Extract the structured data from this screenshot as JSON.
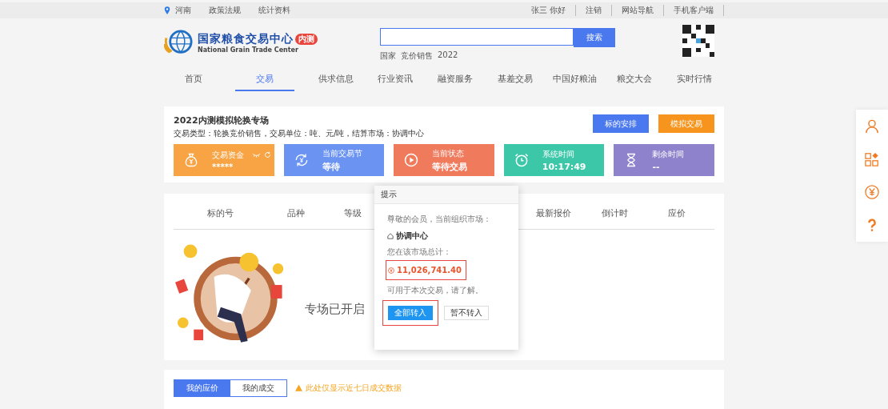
{
  "top_bar": {
    "location": "河南",
    "links": [
      "政策法规",
      "统计资料"
    ],
    "user_links": [
      "张三 你好",
      "注销",
      "网站导航",
      "手机客户端"
    ]
  },
  "header": {
    "logo_title": "国家粮食交易中心",
    "logo_badge": "内测",
    "logo_subtitle": "National Grain Trade Center",
    "search": {
      "button": "搜索"
    },
    "hot_words": [
      "国家",
      "竞价销售",
      "2022"
    ]
  },
  "nav": [
    {
      "label": "首页",
      "selected": false
    },
    {
      "label": "交易",
      "selected": true
    },
    {
      "label": "供求信息",
      "selected": false
    },
    {
      "label": "行业资讯",
      "selected": false
    },
    {
      "label": "融资服务",
      "selected": false
    },
    {
      "label": "基差交易",
      "selected": false
    },
    {
      "label": "中国好粮油",
      "selected": false
    },
    {
      "label": "粮交大会",
      "selected": false
    },
    {
      "label": "实时行情",
      "selected": false
    }
  ],
  "session": {
    "title": "2022内测模拟轮换专场",
    "subtitle": "交易类型：轮换竞价销售，交易单位：吨、元/吨，结算市场：协调中心",
    "buttons": [
      {
        "label": "标的安排",
        "color": "#4a78ef"
      },
      {
        "label": "模拟交易",
        "color": "#f7941d"
      }
    ],
    "tiles": [
      {
        "kind": "funds",
        "label": "交易资金",
        "value": "*****",
        "color": "#f8a444"
      },
      {
        "kind": "plain",
        "label": "当前交易节",
        "value": "等待",
        "color": "#6a93f2"
      },
      {
        "kind": "plain",
        "label": "当前状态",
        "value": "等待交易",
        "color": "#f07a5c"
      },
      {
        "kind": "plain",
        "label": "系统时间",
        "value": "10:17:49",
        "color": "#3cc7a8"
      },
      {
        "kind": "plain",
        "label": "剩余时间",
        "value": "--",
        "color": "#8e82cc"
      }
    ]
  },
  "table": {
    "columns": [
      "标的号",
      "品种",
      "等级",
      "最新报价",
      "倒计时",
      "应价"
    ],
    "empty_message": "专场已开启"
  },
  "dialog": {
    "title": "提示",
    "greeting": "尊敬的会员，当前组织市场：",
    "market": "协调中心",
    "total_label": "您在该市场总计：",
    "amount": "11,026,741.40",
    "amount_highlighted": true,
    "note": "可用于本次交易，请了解。",
    "buttons": [
      {
        "label": "全部转入",
        "kind": "primary",
        "highlighted": true
      },
      {
        "label": "暂不转入",
        "kind": "secondary",
        "highlighted": false
      }
    ]
  },
  "bottom_tabs": [
    {
      "label": "我的应价",
      "selected": true
    },
    {
      "label": "我的成交",
      "selected": false
    }
  ],
  "notice": "此处仅显示近七日成交数据"
}
